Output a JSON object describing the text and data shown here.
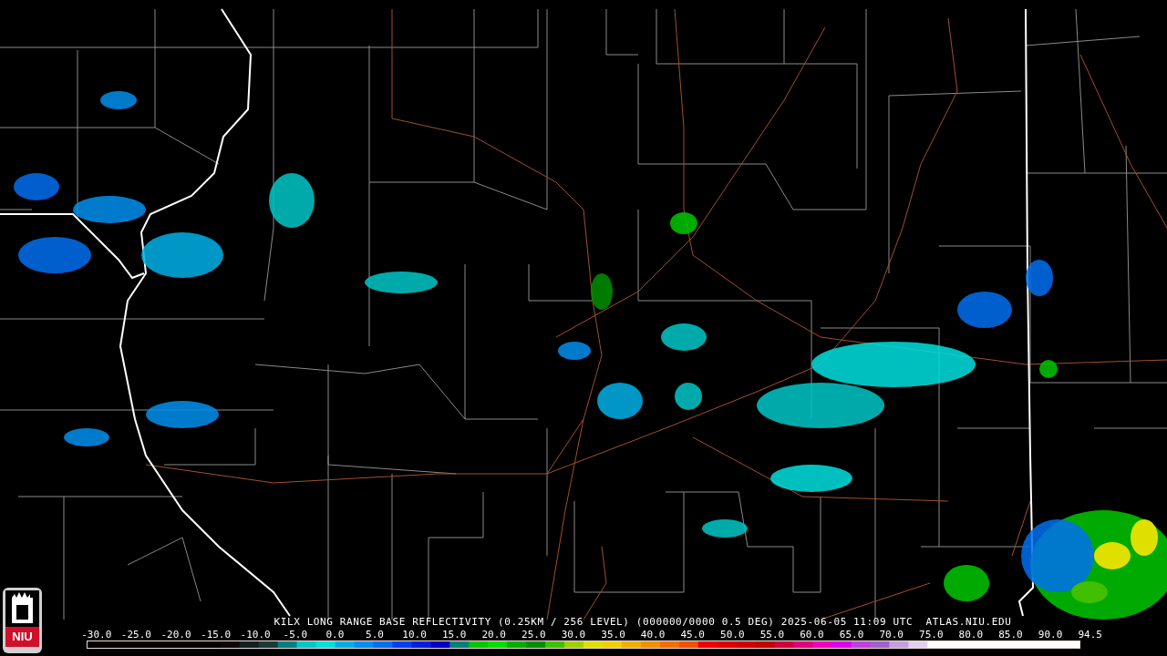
{
  "caption": "KILX LONG RANGE BASE REFLECTIVITY (0.25KM / 256 LEVEL) (000000/0000 0.5 DEG) 2025-06-05 11:09 UTC  ATLAS.NIU.EDU",
  "logo": {
    "text": "NIU"
  },
  "scale_labels": [
    "-30.0",
    "-25.0",
    "-20.0",
    "-15.0",
    "-10.0",
    "-5.0",
    "0.0",
    "5.0",
    "10.0",
    "15.0",
    "20.0",
    "25.0",
    "30.0",
    "35.0",
    "40.0",
    "45.0",
    "50.0",
    "55.0",
    "60.0",
    "65.0",
    "70.0",
    "75.0",
    "80.0",
    "85.0",
    "90.0",
    "94.5"
  ]
}
